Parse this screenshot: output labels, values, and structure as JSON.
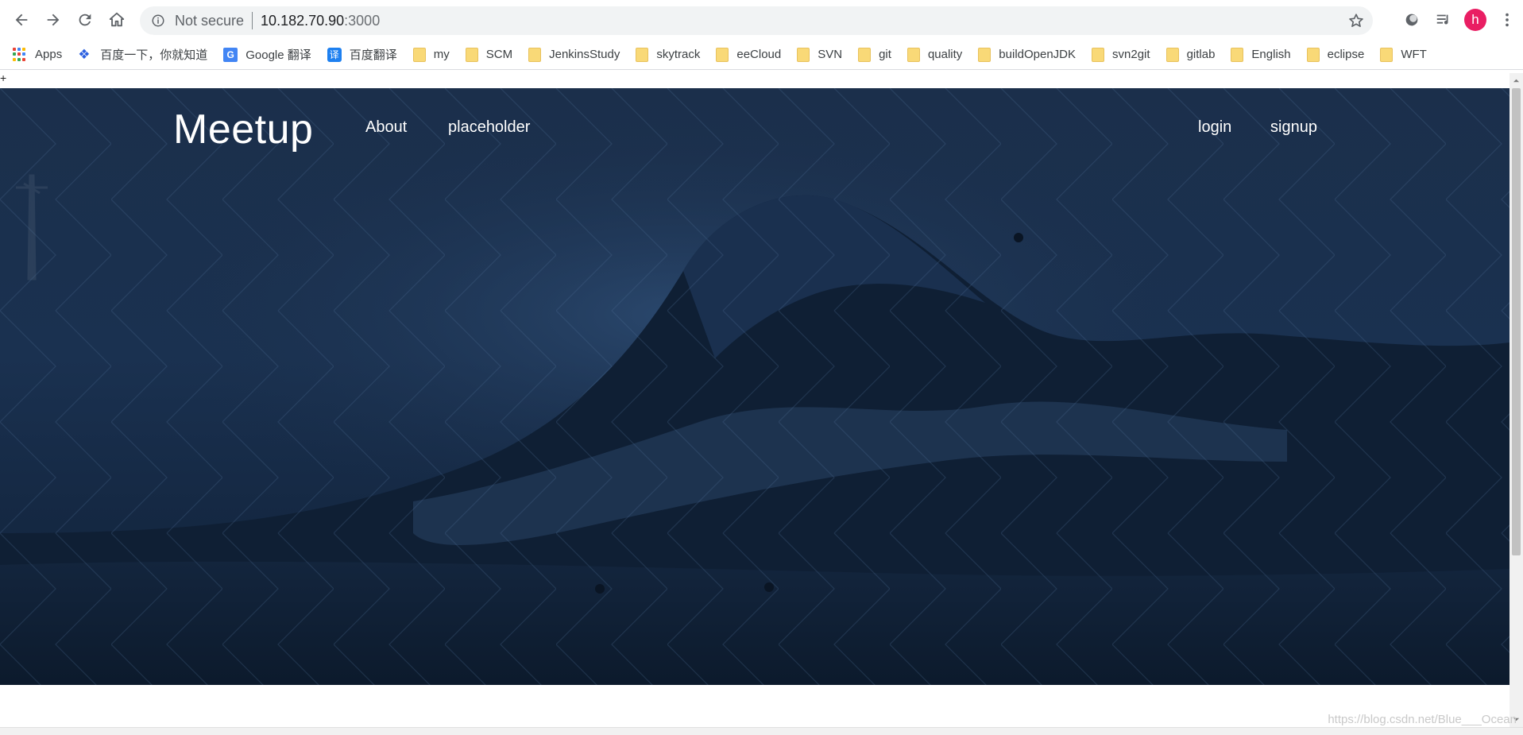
{
  "browser": {
    "security_label": "Not secure",
    "url_host": "10.182.70.90",
    "url_port": ":3000",
    "profile_initial": "h"
  },
  "bookmarks": [
    {
      "label": "Apps",
      "icon": "apps-grid-icon"
    },
    {
      "label": "百度一下，你就知道",
      "icon": "baidu-paw-icon"
    },
    {
      "label": "Google 翻译",
      "icon": "google-translate-icon"
    },
    {
      "label": "百度翻译",
      "icon": "baidu-translate-icon"
    },
    {
      "label": "my",
      "icon": "folder-icon"
    },
    {
      "label": "SCM",
      "icon": "folder-icon"
    },
    {
      "label": "JenkinsStudy",
      "icon": "folder-icon"
    },
    {
      "label": "skytrack",
      "icon": "folder-icon"
    },
    {
      "label": "eeCloud",
      "icon": "folder-icon"
    },
    {
      "label": "SVN",
      "icon": "folder-icon"
    },
    {
      "label": "git",
      "icon": "folder-icon"
    },
    {
      "label": "quality",
      "icon": "folder-icon"
    },
    {
      "label": "buildOpenJDK",
      "icon": "folder-icon"
    },
    {
      "label": "svn2git",
      "icon": "folder-icon"
    },
    {
      "label": "gitlab",
      "icon": "folder-icon"
    },
    {
      "label": "English",
      "icon": "folder-icon"
    },
    {
      "label": "eclipse",
      "icon": "folder-icon"
    },
    {
      "label": "WFT",
      "icon": "folder-icon"
    }
  ],
  "page": {
    "top_marker": "+",
    "brand": "Meetup",
    "nav_left": [
      "About",
      "placeholder"
    ],
    "nav_right": [
      "login",
      "signup"
    ]
  },
  "watermark": "https://blog.csdn.net/Blue___Ocean",
  "colors": {
    "hero_overlay": "#14263f",
    "avatar": "#e91e63",
    "folder": "#f9d977"
  }
}
